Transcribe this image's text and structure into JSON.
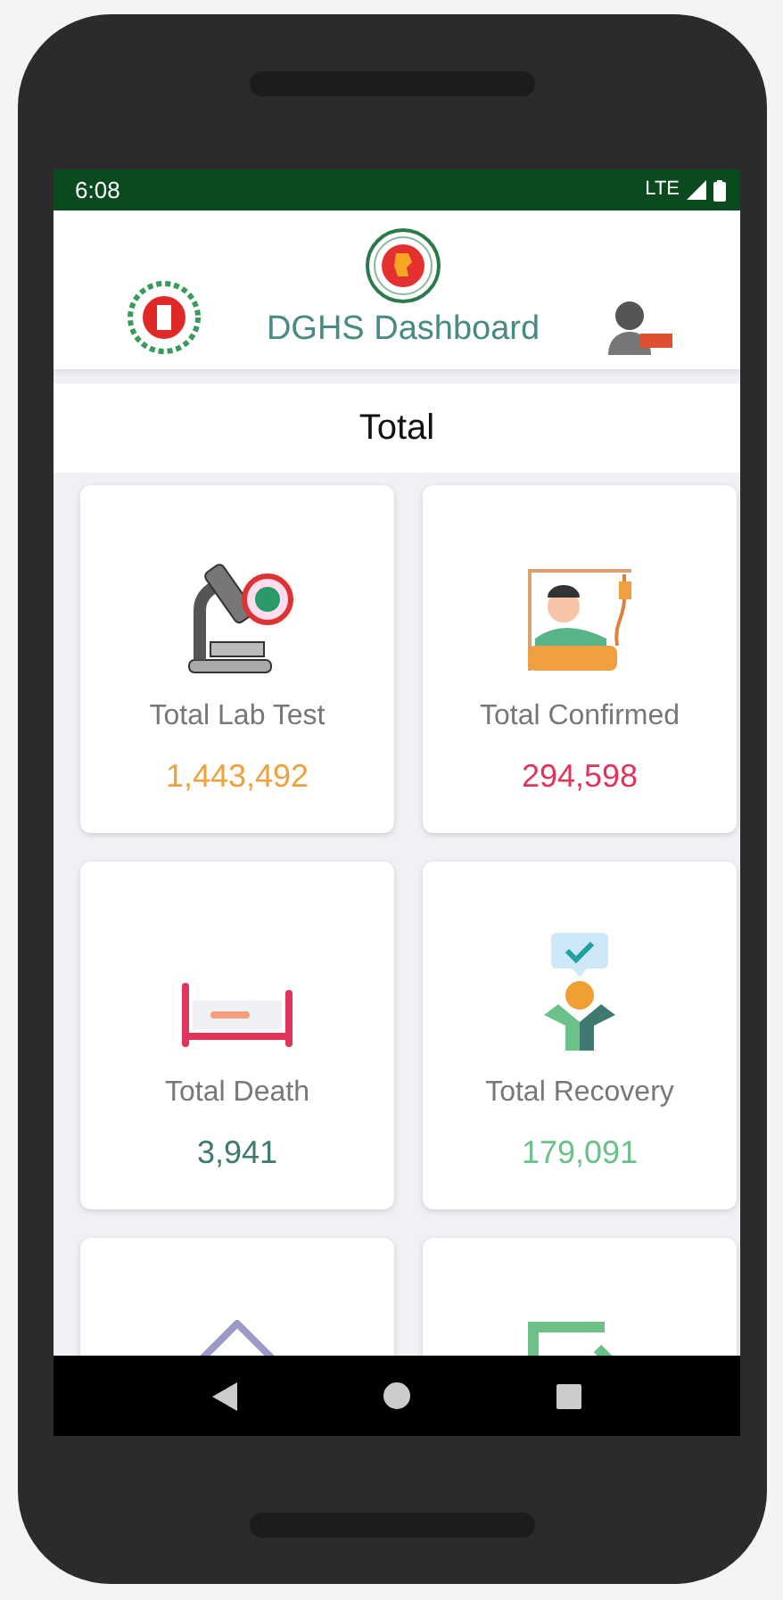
{
  "status_bar": {
    "time": "6:08",
    "network": "LTE"
  },
  "header": {
    "title": "DGHS Dashboard"
  },
  "section": {
    "title": "Total"
  },
  "cards": [
    {
      "kind": "microscope",
      "label": "Total Lab Test",
      "value": "1,443,492",
      "color": "#f0a03c"
    },
    {
      "kind": "patient",
      "label": "Total Confirmed",
      "value": "294,598",
      "color": "#e0345a"
    },
    {
      "kind": "bed",
      "label": "Total Death",
      "value": "3,941",
      "color": "#3e7a72"
    },
    {
      "kind": "recovery",
      "label": "Total Recovery",
      "value": "179,091",
      "color": "#6cc08a"
    },
    {
      "kind": "diamond"
    },
    {
      "kind": "frame"
    }
  ]
}
